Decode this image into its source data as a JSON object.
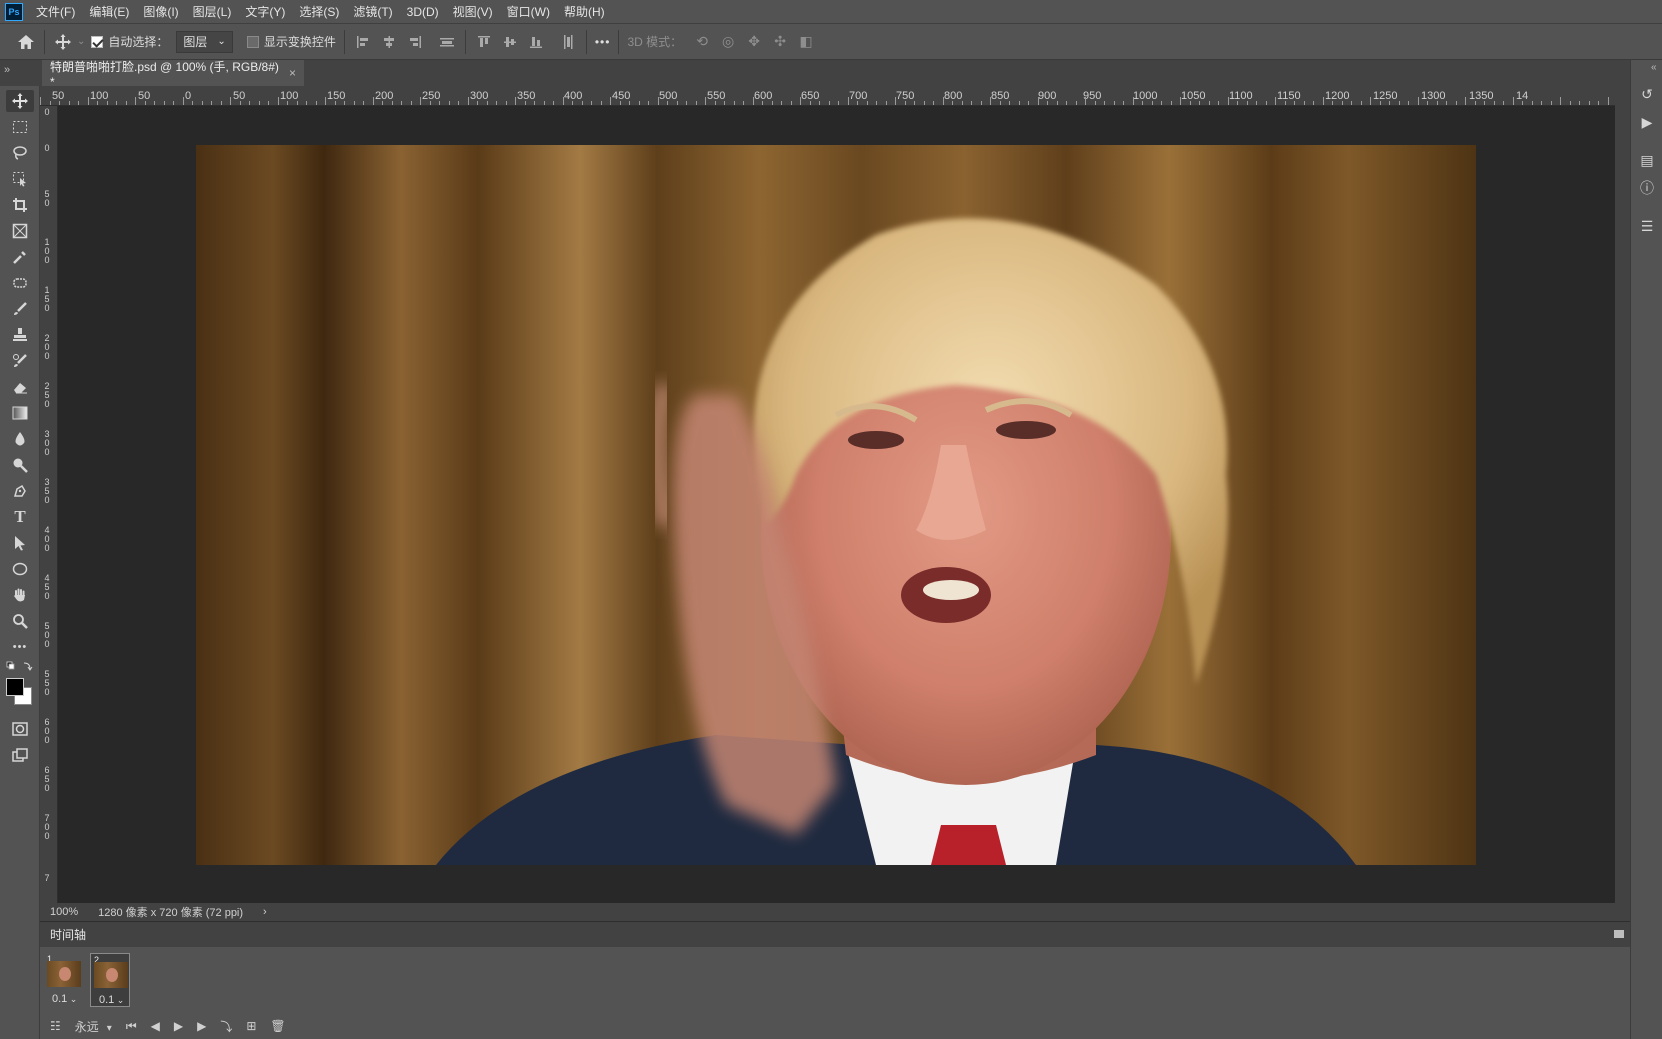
{
  "app": {
    "logo_text": "Ps"
  },
  "menu": {
    "items": [
      "文件(F)",
      "编辑(E)",
      "图像(I)",
      "图层(L)",
      "文字(Y)",
      "选择(S)",
      "滤镜(T)",
      "3D(D)",
      "视图(V)",
      "窗口(W)",
      "帮助(H)"
    ]
  },
  "options": {
    "auto_select_label": "自动选择：",
    "auto_select_checked": true,
    "auto_select_target": "图层",
    "show_transform_label": "显示变换控件",
    "show_transform_checked": false,
    "more_label": "•••",
    "mode3d_label": "3D 模式："
  },
  "document": {
    "tab_title": "特朗普啪啪打脸.psd @ 100% (手, RGB/8#) *",
    "close_glyph": "×"
  },
  "ruler": {
    "h_labels": [
      "50",
      "100",
      "50",
      "0",
      "50",
      "100",
      "150",
      "200",
      "250",
      "300",
      "350",
      "400",
      "450",
      "500",
      "550",
      "600",
      "650",
      "700",
      "750",
      "800",
      "850",
      "900",
      "950",
      "1000",
      "1050",
      "1100",
      "1150",
      "1200",
      "1250",
      "1300",
      "1350",
      "14"
    ],
    "v_labels": [
      "0",
      "0",
      "50",
      "100",
      "150",
      "200",
      "250",
      "300",
      "350",
      "400",
      "450",
      "500",
      "550",
      "600",
      "650",
      "700",
      "7"
    ]
  },
  "status": {
    "zoom": "100%",
    "doc_info": "1280 像素 x 720 像素 (72 ppi)",
    "arrow": "›"
  },
  "timeline": {
    "title": "时间轴",
    "frames": [
      {
        "num": "1",
        "delay": "0.1",
        "selected": false
      },
      {
        "num": "2",
        "delay": "0.1",
        "selected": true
      }
    ],
    "loop_label": "永远"
  },
  "colors": {
    "ui_bg": "#535353",
    "panel_dark": "#424242",
    "canvas_bg": "#282828",
    "ps_blue": "#31a8ff"
  },
  "icons": {
    "tools": [
      "move-icon",
      "marquee-icon",
      "lasso-icon",
      "object-select-icon",
      "crop-icon",
      "frame-icon",
      "eyedropper-icon",
      "patch-icon",
      "brush-icon",
      "stamp-icon",
      "history-brush-icon",
      "eraser-icon",
      "gradient-icon",
      "blur-icon",
      "dodge-icon",
      "pen-icon",
      "type-icon",
      "path-select-icon",
      "ellipse-icon",
      "hand-icon",
      "zoom-icon",
      "more-tools-icon"
    ],
    "right_panel": [
      "history-icon",
      "actions-icon",
      "libraries-icon",
      "info-icon",
      "properties-icon"
    ]
  }
}
